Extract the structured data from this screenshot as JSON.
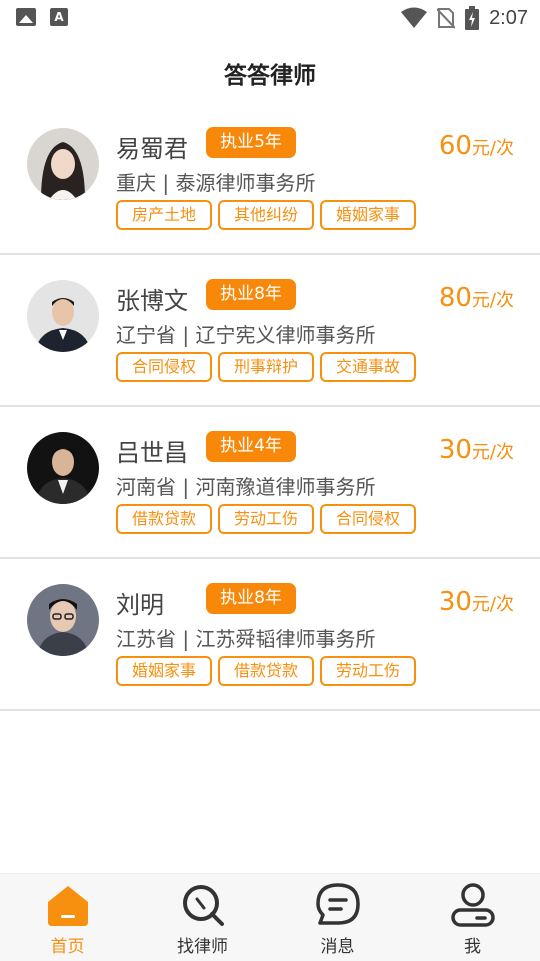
{
  "status_bar": {
    "time": "2:07",
    "icons": [
      "image-icon",
      "text-a-icon",
      "wifi-icon",
      "no-sim-icon",
      "battery-icon"
    ]
  },
  "header": {
    "title": "答答律师"
  },
  "lawyers": [
    {
      "name": "易蜀君",
      "experience": "执业5年",
      "price_value": "60",
      "price_unit": "元/次",
      "firm": "重庆 | 泰源律师事务所",
      "tags": [
        "房产土地",
        "其他纠纷",
        "婚姻家事"
      ]
    },
    {
      "name": "张博文",
      "experience": "执业8年",
      "price_value": "80",
      "price_unit": "元/次",
      "firm": "辽宁省 | 辽宁宪义律师事务所",
      "tags": [
        "合同侵权",
        "刑事辩护",
        "交通事故"
      ]
    },
    {
      "name": "吕世昌",
      "experience": "执业4年",
      "price_value": "30",
      "price_unit": "元/次",
      "firm": "河南省 | 河南豫道律师事务所",
      "tags": [
        "借款贷款",
        "劳动工伤",
        "合同侵权"
      ]
    },
    {
      "name": "刘明",
      "experience": "执业8年",
      "price_value": "30",
      "price_unit": "元/次",
      "firm": "江苏省 | 江苏舜韬律师事务所",
      "tags": [
        "婚姻家事",
        "借款贷款",
        "劳动工伤"
      ]
    }
  ],
  "bottom_nav": {
    "items": [
      {
        "label": "首页",
        "icon": "home-icon",
        "active": true
      },
      {
        "label": "找律师",
        "icon": "search-icon",
        "active": false
      },
      {
        "label": "消息",
        "icon": "message-icon",
        "active": false
      },
      {
        "label": "我",
        "icon": "profile-icon",
        "active": false
      }
    ]
  },
  "colors": {
    "accent": "#f7900f",
    "badge": "#f8880a",
    "divider": "#e3e3e3",
    "nav_bg": "#f7f7f7"
  }
}
